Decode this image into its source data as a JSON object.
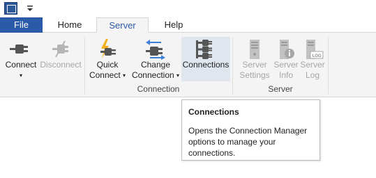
{
  "quick_access": {
    "app_icon": "app-logo-icon",
    "dropdown_icon": "chevron-down-icon"
  },
  "tabs": [
    {
      "label": "File"
    },
    {
      "label": "Home"
    },
    {
      "label": "Server"
    },
    {
      "label": "Help"
    }
  ],
  "ribbon": {
    "connection_group": {
      "label": "Connection",
      "connect": {
        "label": "Connect"
      },
      "disconnect": {
        "label": "Disconnect"
      },
      "quick_connect": {
        "line1": "Quick",
        "line2": "Connect"
      },
      "change_connection": {
        "line1": "Change",
        "line2": "Connection"
      },
      "connections": {
        "label": "Connections"
      }
    },
    "server_group": {
      "label": "Server",
      "settings": {
        "line1": "Server",
        "line2": "Settings"
      },
      "info": {
        "line1": "Server",
        "line2": "Info"
      },
      "log": {
        "line1": "Server",
        "line2": "Log"
      }
    }
  },
  "tooltip": {
    "title": "Connections",
    "body": "Opens the Connection Manager options to manage your connections."
  },
  "colors": {
    "file_tab": "#2b5aa8",
    "active_tab_text": "#2b5aa8",
    "ribbon_bg": "#f4f4f4",
    "disabled_text": "#a6a6a6",
    "lightning": "#f2b01e",
    "arrows": "#3d7fd6"
  }
}
